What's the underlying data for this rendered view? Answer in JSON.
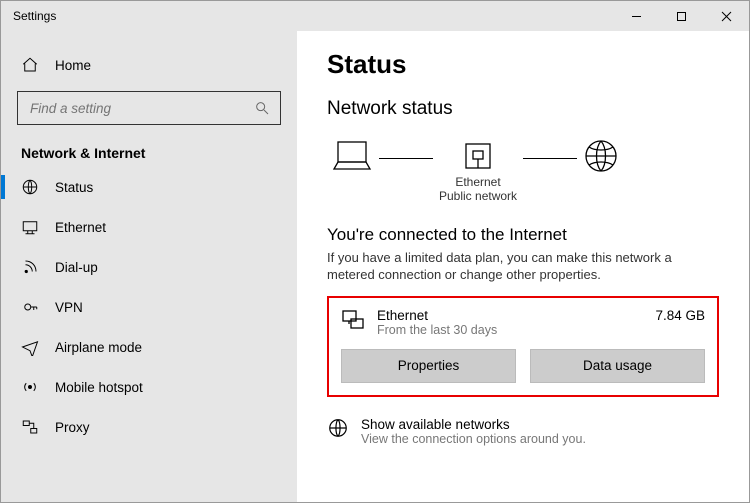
{
  "window": {
    "title": "Settings"
  },
  "sidebar": {
    "home": "Home",
    "search_placeholder": "Find a setting",
    "section": "Network & Internet",
    "items": [
      {
        "label": "Status"
      },
      {
        "label": "Ethernet"
      },
      {
        "label": "Dial-up"
      },
      {
        "label": "VPN"
      },
      {
        "label": "Airplane mode"
      },
      {
        "label": "Mobile hotspot"
      },
      {
        "label": "Proxy"
      }
    ]
  },
  "main": {
    "title": "Status",
    "subtitle": "Network status",
    "diagram": {
      "middle_label1": "Ethernet",
      "middle_label2": "Public network"
    },
    "connected": {
      "heading": "You're connected to the Internet",
      "desc": "If you have a limited data plan, you can make this network a metered connection or change other properties."
    },
    "network_card": {
      "name": "Ethernet",
      "sub": "From the last 30 days",
      "usage": "7.84 GB",
      "btn_properties": "Properties",
      "btn_data_usage": "Data usage"
    },
    "available": {
      "title": "Show available networks",
      "sub": "View the connection options around you."
    }
  }
}
